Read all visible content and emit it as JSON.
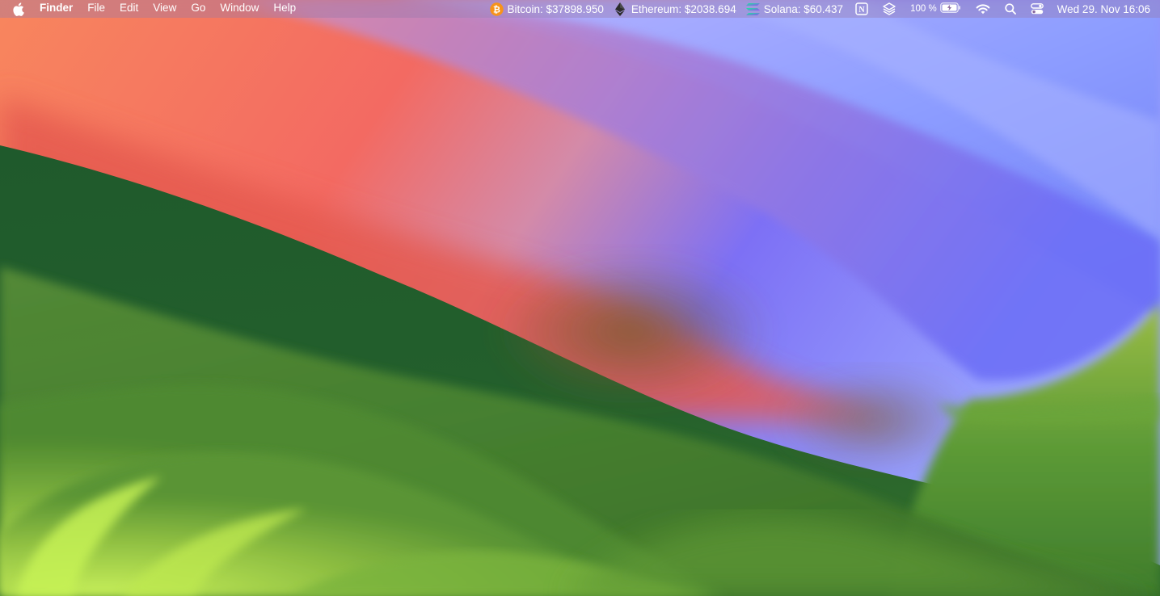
{
  "menubar": {
    "apple_icon": "apple-logo-icon",
    "app_name": "Finder",
    "menus": [
      "File",
      "Edit",
      "View",
      "Go",
      "Window",
      "Help"
    ],
    "tickers": [
      {
        "icon": "bitcoin-icon",
        "label": "Bitcoin: $37898.950",
        "color": "#f7931a"
      },
      {
        "icon": "ethereum-icon",
        "label": "Ethereum: $2038.694",
        "color": "#2b2b2b"
      },
      {
        "icon": "solana-icon",
        "label": "Solana: $60.437",
        "color": "#14f195"
      }
    ],
    "status_icons": [
      "notion-icon",
      "layers-icon"
    ],
    "battery": {
      "percent_label": "100 %",
      "level": 1.0,
      "icon": "battery-charging-icon"
    },
    "wifi_icon": "wifi-icon",
    "search_icon": "spotlight-search-icon",
    "control_center_icon": "control-center-icon",
    "clock": "Wed 29. Nov  16:06"
  },
  "wallpaper": {
    "name": "macOS Sonoma",
    "colors": {
      "orange": "#f8865e",
      "coral": "#f36a62",
      "pink": "#d889a8",
      "violet": "#7a6ef6",
      "blue": "#8a9cff",
      "dark_green": "#1f5a2c",
      "mid_green": "#4f8a34",
      "light_green": "#b8e052"
    }
  }
}
